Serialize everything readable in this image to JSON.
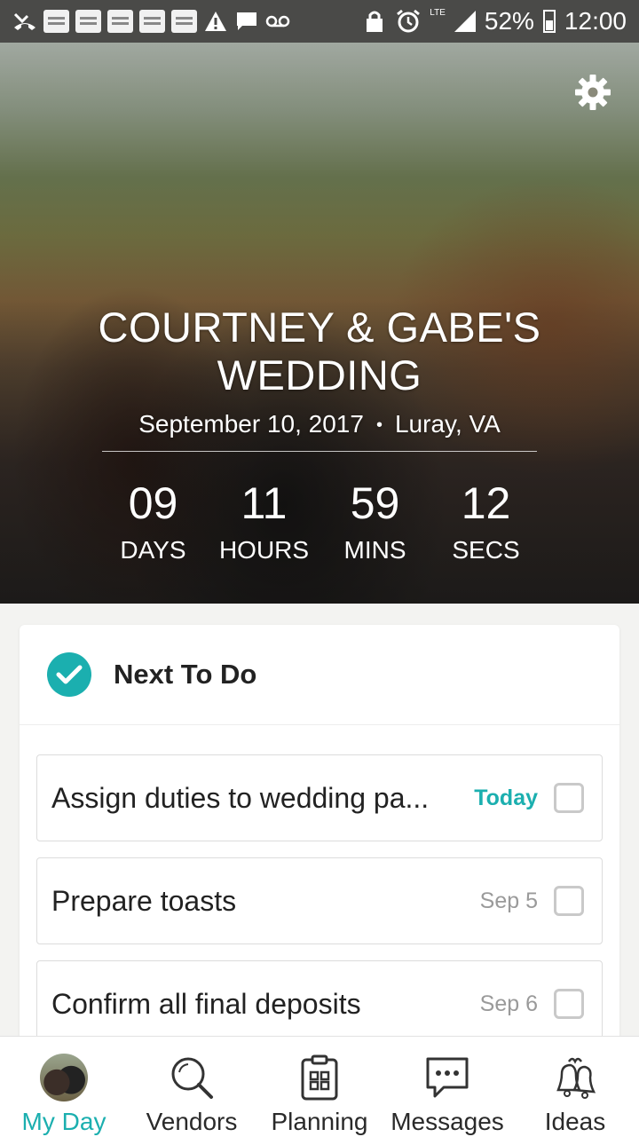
{
  "status_bar": {
    "battery": "52%",
    "time": "12:00",
    "network": "LTE"
  },
  "hero": {
    "title": "COURTNEY & GABE'S WEDDING",
    "date": "September 10, 2017",
    "separator": "•",
    "location": "Luray, VA",
    "countdown": [
      {
        "value": "09",
        "label": "DAYS"
      },
      {
        "value": "11",
        "label": "HOURS"
      },
      {
        "value": "59",
        "label": "MINS"
      },
      {
        "value": "12",
        "label": "SECS"
      }
    ]
  },
  "next_to_do": {
    "title": "Next To Do",
    "tasks": [
      {
        "text": "Assign duties to wedding pa...",
        "date": "Today",
        "checked": false
      },
      {
        "text": "Prepare toasts",
        "date": "Sep 5",
        "checked": false
      },
      {
        "text": "Confirm all final deposits",
        "date": "Sep 6",
        "checked": false
      }
    ]
  },
  "bottom_nav": [
    {
      "label": "My Day",
      "icon": "avatar-icon",
      "active": true
    },
    {
      "label": "Vendors",
      "icon": "search-icon",
      "active": false
    },
    {
      "label": "Planning",
      "icon": "clipboard-icon",
      "active": false
    },
    {
      "label": "Messages",
      "icon": "chat-icon",
      "active": false
    },
    {
      "label": "Ideas",
      "icon": "bells-icon",
      "active": false
    }
  ],
  "colors": {
    "accent": "#1bafaf",
    "status_bar": "#4a4a48"
  }
}
